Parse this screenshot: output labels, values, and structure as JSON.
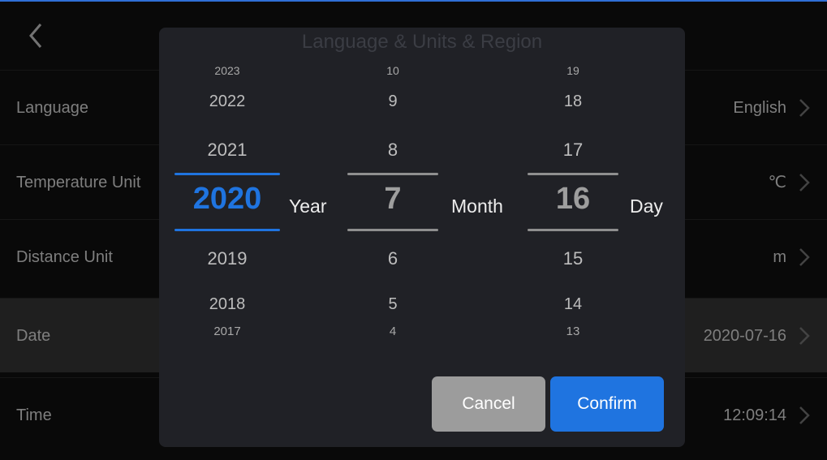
{
  "header": {
    "title": "Language & Units & Region"
  },
  "settings": [
    {
      "label": "Language",
      "value": "English"
    },
    {
      "label": "Temperature Unit",
      "value": "℃"
    },
    {
      "label": "Distance Unit",
      "value": "m"
    },
    {
      "label": "Date",
      "value": "2020-07-16"
    },
    {
      "label": "Time",
      "value": "12:09:14"
    }
  ],
  "picker": {
    "year": {
      "items": [
        "2023",
        "2022",
        "2021",
        "2020",
        "2019",
        "2018",
        "2017"
      ],
      "unit": "Year"
    },
    "month": {
      "items": [
        "10",
        "9",
        "8",
        "7",
        "6",
        "5",
        "4"
      ],
      "unit": "Month"
    },
    "day": {
      "items": [
        "19",
        "18",
        "17",
        "16",
        "15",
        "14",
        "13"
      ],
      "unit": "Day"
    }
  },
  "buttons": {
    "cancel": "Cancel",
    "confirm": "Confirm"
  },
  "colors": {
    "accent": "#1f74e0",
    "selected_year": "#1f74e0",
    "cancel_bg": "#9c9c9c"
  }
}
